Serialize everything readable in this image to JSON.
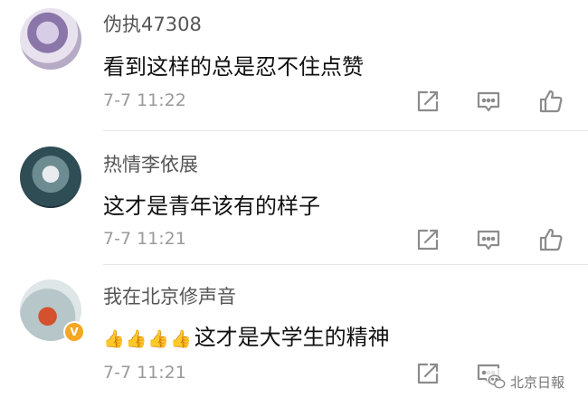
{
  "comments": [
    {
      "username": "伪执47308",
      "content": "看到这样的总是忍不住点赞",
      "time": "7-7 11:22",
      "avatar_icon": "anime-girl-avatar"
    },
    {
      "username": "热情李依展",
      "content": "这才是青年该有的样子",
      "time": "7-7 11:21",
      "avatar_icon": "flower-photo-avatar"
    },
    {
      "username": "我在北京修声音",
      "content": "这才是大学生的精神",
      "content_prefix_emoji": [
        "👍",
        "👍",
        "👍",
        "👍"
      ],
      "time": "7-7 11:21",
      "avatar_icon": "red-bead-bracelet-avatar",
      "verified_badge": "V"
    }
  ],
  "actions": {
    "share_icon": "share-icon",
    "reply_icon": "comment-icon",
    "like_icon": "thumbs-up-icon"
  },
  "watermark": {
    "text": "北京日報",
    "icon": "wechat-icon"
  },
  "colors": {
    "username": "#555555",
    "content": "#111111",
    "time": "#9a9a9a",
    "icon_stroke": "#8c8c8c",
    "verified": "#f6a623"
  }
}
